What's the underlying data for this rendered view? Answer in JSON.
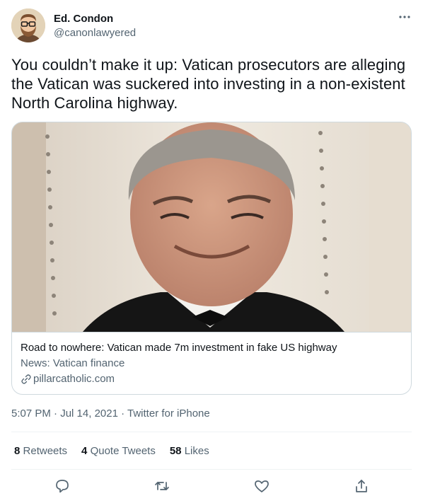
{
  "author": {
    "display_name": "Ed. Condon",
    "handle": "@canonlawyered",
    "avatar_icon": "bearded-man-avatar"
  },
  "tweet": {
    "text": "You couldn’t make it up: Vatican prosecutors are alleging the Vatican was suckered into investing in a non-existent North Carolina highway."
  },
  "card": {
    "title": "Road to nowhere: Vatican made 7m investment in fake US highway",
    "description": "News: Vatican finance",
    "domain": "pillarcatholic.com",
    "link_icon": "link-icon"
  },
  "meta": {
    "time": "5:07 PM",
    "separator": " · ",
    "date": "Jul 14, 2021",
    "source": "Twitter for iPhone"
  },
  "stats": {
    "retweets_count": "8",
    "retweets_label": "Retweets",
    "quotes_count": "4",
    "quotes_label": "Quote Tweets",
    "likes_count": "58",
    "likes_label": "Likes"
  },
  "actions": [
    "reply-icon",
    "retweet-icon",
    "like-icon",
    "share-icon"
  ],
  "colors": {
    "text_primary": "#0f1419",
    "text_secondary": "#536471",
    "border": "#cfd9de",
    "divider": "#eff3f4"
  }
}
